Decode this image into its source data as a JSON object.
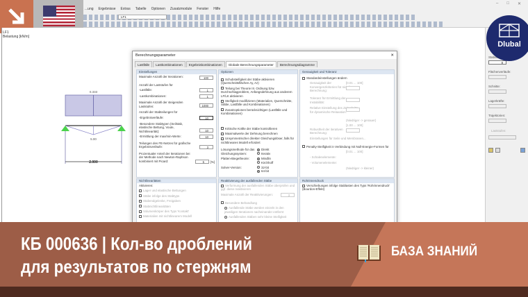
{
  "app": {
    "menu": [
      "...ung",
      "Ergebnisse",
      "Extras",
      "Tabelle",
      "Optionen",
      "Zusatzmodule",
      "Fenster",
      "Hilfe"
    ],
    "loadcase_select": "LF1",
    "window_controls": [
      "–",
      "□",
      "✕"
    ]
  },
  "canvas": {
    "loadcase": "LF1",
    "load_label": "Belastung [kN/m]",
    "load_value": "0.333",
    "deflection_value": "5.00",
    "span": "2.000"
  },
  "dialog": {
    "title": "Berechnungsparameter",
    "close": "✕",
    "tabs": [
      "Lastfälle",
      "Lastkombinationen",
      "Ergebniskombinationen",
      "Globale Berechnungsparameter",
      "Berechnungsdiagramme"
    ],
    "settings": {
      "header": "Einstellungen",
      "max_iter_label": "Maximale Anzahl der Iterationen:",
      "max_iter": "100",
      "steps_label": "Anzahl der Laststufen für",
      "lf_label": "-Lastfälle:",
      "lf": "1",
      "lk_label": "-Lastkombinationen:",
      "lk": "1",
      "max_steps_label": "Maximale Anzahl der steigenden Laststufen:",
      "max_steps": "1000",
      "div_label": "Anzahl der Stabteilungen für",
      "res_label": "-Ergebnisverläufe:",
      "res": "10",
      "special_label": "-Besondere Stabtypen (Seilstab, elastische Bettung, Voute, Nichtlinearität):",
      "special": "10",
      "maxmin_label": "-Ermittlung der max/min-Werte:",
      "maxmin": "10",
      "fe_label": "Teilungen des FE-Netzes für grafische Ergebnisverläufe:",
      "fe": "3",
      "picard_label": "Prozentualer Anteil der Iterationen bei der Methode nach Newton-Raphson kombiniert mit Picard:",
      "picard": "5",
      "picard_unit": "[%]"
    },
    "options": {
      "header": "Optionen",
      "items": [
        "Schubsteifigkeit der Stäbe aktivieren (Querschnittsflächen Ay, Az)",
        "Teilung bei Theorie III. Ordnung bzw. Durchschlagproblem, Anfangsdehnung aus anderem LF/LK aktivieren",
        "Steifigkeit modifizieren (Materialien, Querschnitte, Stäbe, Lastfälle und Kombinationen)",
        "Zusatzoptionen berücksichtigen (Lastfälle und Kombinationen)",
        "Kritische Kräfte der Stäbe kontrollieren",
        "Maximalwerte der Dehnung berechnen",
        "Unsymmetrischer direkter Gleichungslöser, falls für nichtlineares Modell erfordert"
      ],
      "solver_method_label": "Lösungsmethode für das Gleichungssystem:",
      "solver_methods": [
        "Direkt",
        "Iterativ"
      ],
      "plate_label": "Platten-Biegetheorie:",
      "plates": [
        "Mindlin",
        "Kirchhoff"
      ],
      "version_label": "Solver-Version:",
      "versions": [
        "32-bit",
        "64-bit"
      ]
    },
    "accuracy": {
      "header": "Genauigkeit und Toleranz",
      "change": "Standardeinstellungen ändern",
      "conv_label": "Genauigkeit der Konvergenzkriterien für nichtlineare Berechnung:",
      "conv_range": "[0.01 ... 100]",
      "tol_label": "Toleranz für Ermittlung der Instabilität:",
      "rel_label": "Relative Einstellung des Zeitschritts für dynamische Relaxation:",
      "hint1": "(Niedriger -> genauer)",
      "rob_range": "[1.00 ... 100]",
      "rob_label": "Robustheit der iterativen Berechnung:",
      "cable": "Einstellungen für Seile und Membranen...",
      "penalty": "Penalty-Steifigkeit in Verbindung mit Null-Energie-Formen für",
      "pen_range": "[0.01 ... 100]",
      "shell": "- Schalenelemente:",
      "solid": "- Volumenelemente:",
      "hint2": "(Niedriger -> kleiner)"
    },
    "nonlin": {
      "header": "Nichtlinearitäten",
      "activate": "Aktivieren:",
      "items": [
        "Lager und elastische Bettungen",
        "Stäbe infolge des Stabtyps",
        "Stabendgelenke, Freigaben",
        "Stabnichtlinearitäten",
        "Volumenkörper des Typs 'Kontakt'",
        "Materialien mit nichtlinearem Modell"
      ]
    },
    "react": {
      "header": "Reaktivierung der ausfallenden Stäbe",
      "check": "Verformung der ausfallenden Stäbe überprüfen und ggf. diese reaktivieren",
      "max_label": "Maximale Anzahl der Reaktivierungen:",
      "max": "3",
      "special": "Besondere Behandlung",
      "opt1": "Ausfallende Stäbe werden einzeln in den jeweiligen Iterationen nacheinander entfernt",
      "opt2": "Ausfallenden Stäben sehr kleine Steifigkeit"
    },
    "pipe": {
      "header": "Rohrinnendruck",
      "item": "Verschiebungen infolge Stablasten des Typs 'Rohrinnendruck' (Bourdon-Effekt)"
    }
  },
  "side": {
    "labels": [
      "Stabverläufe:",
      "Flächenverläufe:",
      "Schnitte:",
      "Lagerkräfte:",
      "Trajektorien:",
      "Laststufen:"
    ],
    "stab_value": "8"
  },
  "logo": "Dlubal",
  "banner": {
    "line1": "КБ 000636 | Кол-во дроблений",
    "line2": "для результатов по стержням",
    "kb": "БАЗА ЗНАНИЙ"
  },
  "colors": {
    "banner": "#9d5d47",
    "banner_accent": "#c57659",
    "footer": "#4f2a1f",
    "logo": "#1e2a6e"
  }
}
